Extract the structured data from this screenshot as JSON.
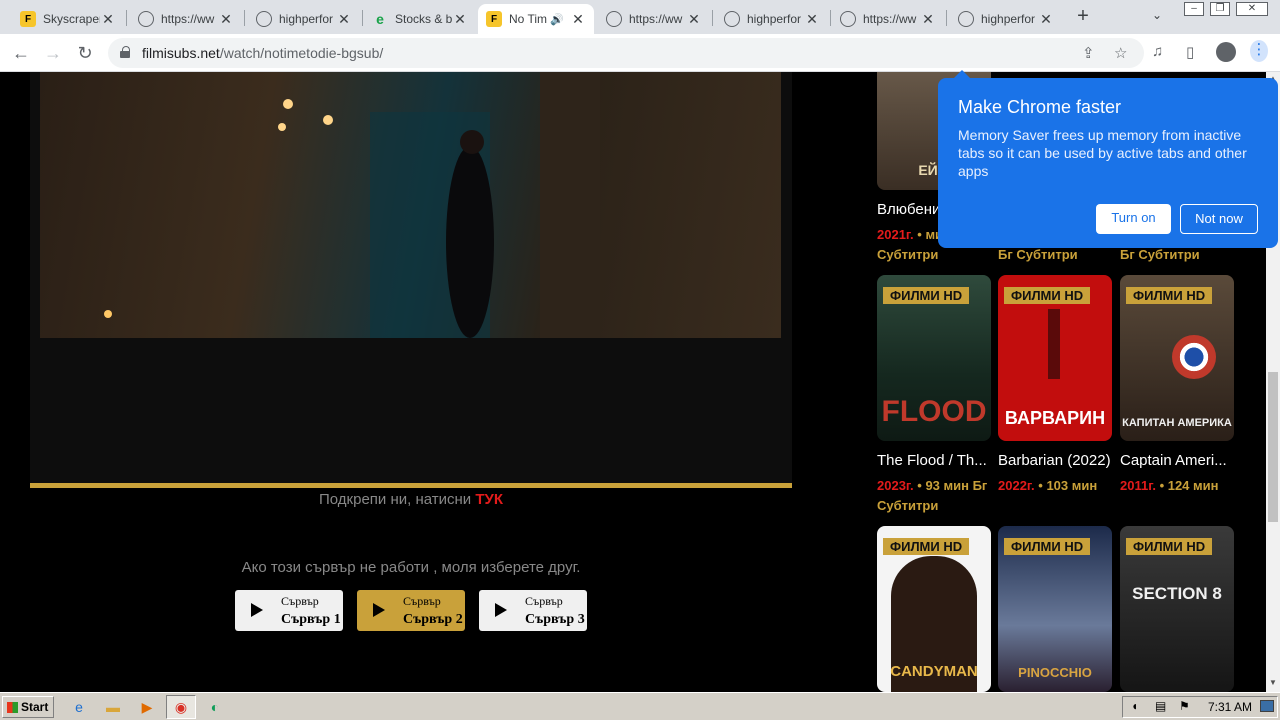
{
  "browser": {
    "tabs": [
      {
        "title": "Skyscraper",
        "icon": "skyscraper-favicon"
      },
      {
        "title": "https://ww",
        "icon": "globe-icon"
      },
      {
        "title": "highperfor",
        "icon": "globe-icon"
      },
      {
        "title": "Stocks & bo",
        "icon": "stocks-favicon"
      },
      {
        "title": "No Tim",
        "icon": "skyscraper-favicon",
        "active": true
      },
      {
        "title": "https://ww",
        "icon": "globe-icon"
      },
      {
        "title": "highperfor",
        "icon": "globe-icon"
      },
      {
        "title": "https://ww",
        "icon": "globe-icon"
      },
      {
        "title": "highperfor",
        "icon": "globe-icon"
      }
    ],
    "url_host": "filmisubs.net",
    "url_path": "/watch/notimetodie-bgsub/"
  },
  "player": {
    "support_text": "Подкрепи ни, натисни",
    "support_link": "ТУК",
    "choose_text": "Ако този сървър не работи , моля изберете друг.",
    "servers": [
      {
        "small": "Сървър",
        "big": "Сървър 1",
        "active": false
      },
      {
        "small": "Сървър",
        "big": "Сървър 2",
        "active": true
      },
      {
        "small": "Сървър",
        "big": "Сървър 3",
        "active": false
      }
    ]
  },
  "movies": {
    "badge": "ФИЛМИ HD",
    "row0": [
      {
        "poster_text": "ЕЙФ",
        "title": "Влюбени",
        "year": "2021г.",
        "extra": "• мин Бг Субтитри"
      },
      {
        "tail": "Бг Субтитри"
      },
      {
        "tail": "Бг Субтитри"
      }
    ],
    "row1": [
      {
        "poster_text": "FLOOD",
        "title": "The Flood / Th...",
        "year": "2023г.",
        "extra": "• 93 мин Бг Субтитри"
      },
      {
        "poster_text": "ВАРВАРИН",
        "title": "Barbarian (2022)",
        "year": "2022г.",
        "extra": "• 103 мин"
      },
      {
        "poster_text": "КАПИТАН АМЕРИКА",
        "title": "Captain Ameri...",
        "year": "2011г.",
        "extra": "• 124 мин"
      }
    ],
    "row2": [
      {
        "poster_text": "CANDYMAN"
      },
      {
        "poster_text": "PINOCCHIO"
      },
      {
        "poster_text": "SECTION 8"
      }
    ]
  },
  "popup": {
    "title": "Make Chrome faster",
    "body": "Memory Saver frees up memory from inactive tabs so it can be used by active tabs and other apps",
    "turn_on": "Turn on",
    "not_now": "Not now"
  },
  "taskbar": {
    "start": "Start",
    "clock": "7:31 AM"
  }
}
